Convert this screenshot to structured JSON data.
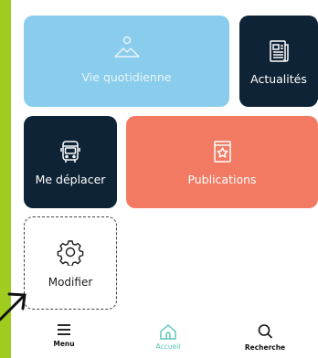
{
  "tiles": [
    {
      "label": "Vie quotidienne",
      "icon": "mountain-sun-icon",
      "color": "#8acceb"
    },
    {
      "label": "Actualités",
      "icon": "newspaper-icon",
      "color": "#0f2336"
    },
    {
      "label": "Me déplacer",
      "icon": "bus-icon",
      "color": "#0f2336"
    },
    {
      "label": "Publications",
      "icon": "star-book-icon",
      "color": "#f27a63"
    },
    {
      "label": "Modifier",
      "icon": "gear-icon",
      "color": "#ffffff"
    }
  ],
  "tabbar": {
    "items": [
      {
        "label": "Menu",
        "icon": "hamburger-icon"
      },
      {
        "label": "Accueil",
        "icon": "home-icon",
        "active": true,
        "active_color": "#56c5b5"
      },
      {
        "label": "Recherche",
        "icon": "search-icon"
      }
    ]
  },
  "colors": {
    "frame": "#9fcc1f",
    "accent": "#56c5b5",
    "dark": "#0f2336"
  }
}
